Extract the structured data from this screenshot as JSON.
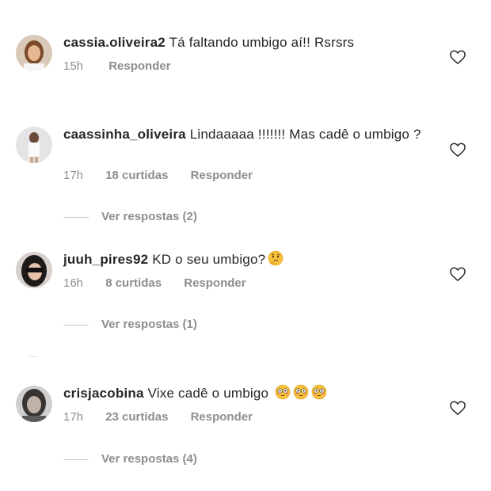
{
  "comments": [
    {
      "username": "cassia.oliveira2",
      "text": " Tá faltando umbigo aí!! Rsrsrs",
      "time": "15h",
      "likes": "",
      "reply": "Responder",
      "view_replies": ""
    },
    {
      "username": "caassinha_oliveira",
      "text": " Lindaaaaa !!!!!!! Mas cadê o umbigo ?",
      "time": "17h",
      "likes": "18 curtidas",
      "reply": "Responder",
      "view_replies": "Ver respostas (2)"
    },
    {
      "username": "juuh_pires92",
      "text": " KD o seu umbigo?",
      "emoji": "thinking-face",
      "time": "16h",
      "likes": "8 curtidas",
      "reply": "Responder",
      "view_replies": "Ver respostas (1)"
    },
    {
      "username": "crisjacobina",
      "text": " Vixe cadê o umbigo ",
      "emoji": "flushed-face",
      "time": "17h",
      "likes": "23 curtidas",
      "reply": "Responder",
      "view_replies": "Ver respostas (4)"
    }
  ],
  "colors": {
    "text": "#262626",
    "secondary": "#8e8e8e",
    "divider": "#c7c7c7"
  }
}
